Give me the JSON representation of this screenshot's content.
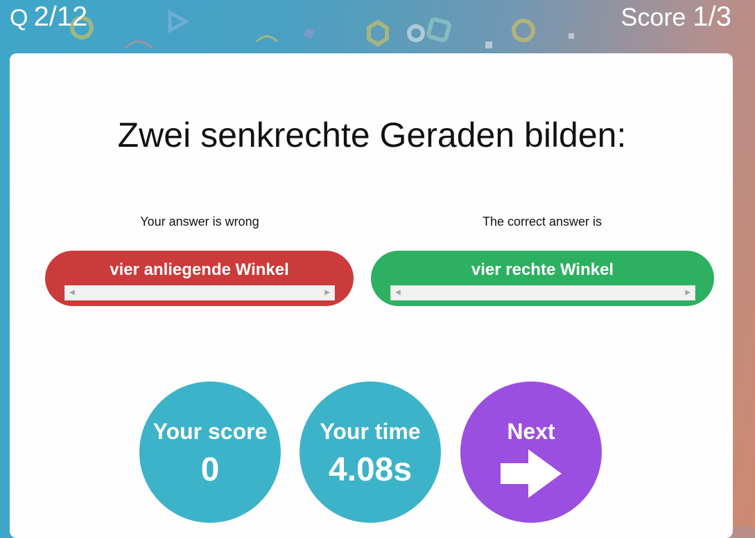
{
  "header": {
    "question_prefix": "Q",
    "question_counter": "2/12",
    "score_label": "Score",
    "score_value": "1/3"
  },
  "question": {
    "text": "Zwei senkrechte Geraden bilden:"
  },
  "answers": {
    "wrong_label": "Your answer is wrong",
    "wrong_answer": "vier anliegende Winkel",
    "correct_label": "The correct answer is",
    "correct_answer": "vier rechte Winkel"
  },
  "stats": {
    "score_label": "Your score",
    "score_value": "0",
    "time_label": "Your time",
    "time_value": "4.08s"
  },
  "next": {
    "label": "Next",
    "icon": "arrow-right-icon"
  },
  "colors": {
    "wrong": "#cc3b3b",
    "correct": "#2eb062",
    "stat_circle": "#3cb3c8",
    "next_circle": "#9b4fe0"
  }
}
